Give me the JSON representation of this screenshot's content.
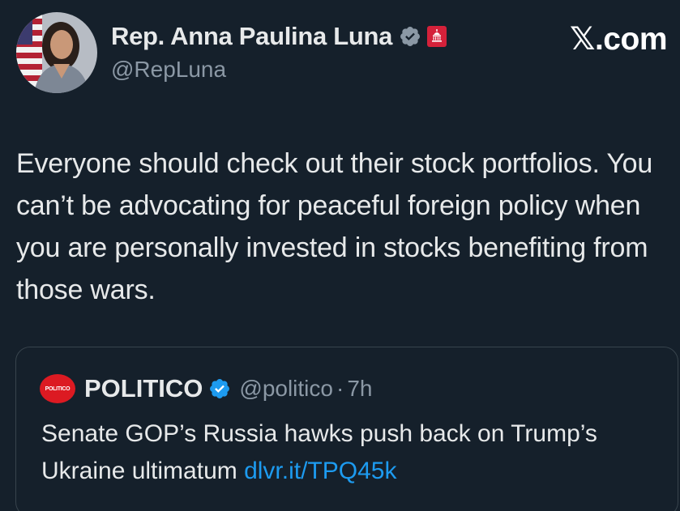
{
  "author": {
    "display_name": "Rep. Anna Paulina Luna",
    "handle": "@RepLuna",
    "verified_badge_icon": "verified-gray-icon",
    "affiliation_badge_icon": "gop-capitol-icon"
  },
  "brand": {
    "logo_text": ".com",
    "logo_glyph": "𝕏"
  },
  "tweet": {
    "text": "Everyone should check out their stock portfolios. You can’t be advocating for peaceful foreign policy when you are personally invested in stocks benefiting from those wars."
  },
  "quoted_tweet": {
    "logo_text": "POLITICO",
    "display_name": "POLITICO",
    "verified_badge_icon": "verified-blue-icon",
    "handle": "@politico",
    "separator": "·",
    "time": "7h",
    "text": "Senate GOP’s Russia hawks push back on Trump’s Ukraine ultimatum ",
    "link": "dlvr.it/TPQ45k"
  },
  "colors": {
    "background": "#15202b",
    "text": "#e7e9ea",
    "muted": "#8b98a5",
    "link": "#1d9bf0",
    "border": "#38444d",
    "gop_red": "#d4213a",
    "politico_red": "#dc1a22"
  }
}
